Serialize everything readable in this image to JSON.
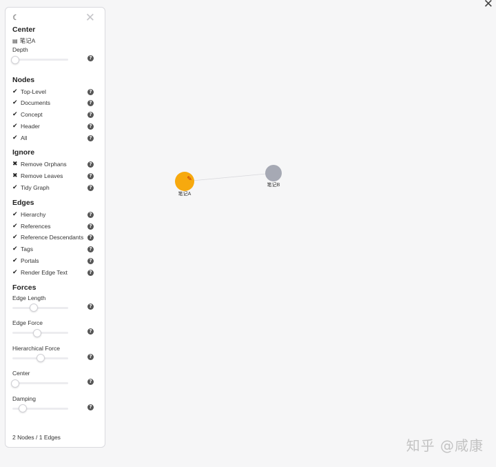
{
  "window": {
    "close_glyph": "✕"
  },
  "panel": {
    "theme_icon": "moon-icon",
    "close_glyph": "✕",
    "center": {
      "heading": "Center",
      "node_name": "笔记A",
      "depth_label": "Depth",
      "depth_value": 0
    },
    "nodes": {
      "heading": "Nodes",
      "items": [
        {
          "label": "Top-Level",
          "checked": true
        },
        {
          "label": "Documents",
          "checked": true
        },
        {
          "label": "Concept",
          "checked": true
        },
        {
          "label": "Header",
          "checked": true
        },
        {
          "label": "All",
          "checked": true
        }
      ]
    },
    "ignore": {
      "heading": "Ignore",
      "items": [
        {
          "label": "Remove Orphans",
          "mark": "✖"
        },
        {
          "label": "Remove Leaves",
          "mark": "✖"
        },
        {
          "label": "Tidy Graph",
          "mark": "✔"
        }
      ]
    },
    "edges": {
      "heading": "Edges",
      "items": [
        {
          "label": "Hierarchy",
          "checked": true
        },
        {
          "label": "References",
          "checked": true
        },
        {
          "label": "Reference Descendants",
          "checked": true
        },
        {
          "label": "Tags",
          "checked": true
        },
        {
          "label": "Portals",
          "checked": true
        },
        {
          "label": "Render Edge Text",
          "checked": true
        }
      ]
    },
    "forces": {
      "heading": "Forces",
      "items": [
        {
          "label": "Edge Length",
          "value": 0.38
        },
        {
          "label": "Edge Force",
          "value": 0.45
        },
        {
          "label": "Hierarchical Force",
          "value": 0.5
        },
        {
          "label": "Center",
          "value": 0.0
        },
        {
          "label": "Damping",
          "value": 0.18
        }
      ]
    },
    "footer": "2 Nodes / 1 Edges"
  },
  "graph": {
    "nodes": [
      {
        "label": "笔记A",
        "color": "#f7a90e",
        "pinned": true
      },
      {
        "label": "笔记B",
        "color": "#a6a9b4",
        "pinned": false
      }
    ],
    "edge_color": "#d8d8dc"
  },
  "watermark": "知乎 @咸康",
  "colors": {
    "accent": "#f7a90e",
    "node_default": "#a6a9b4",
    "background": "#f6f6f7"
  }
}
